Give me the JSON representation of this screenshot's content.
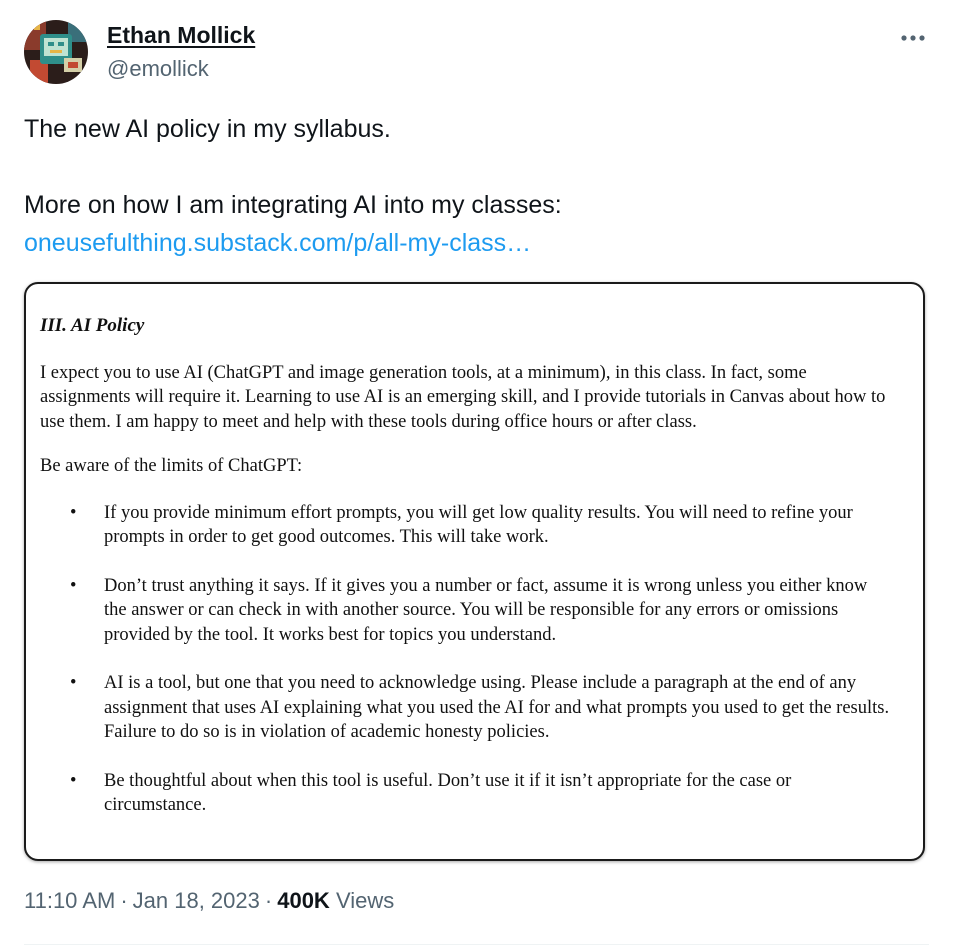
{
  "author": {
    "display_name": "Ethan Mollick",
    "handle": "@emollick",
    "avatar_icon": "pixel-art-avatar"
  },
  "more_icon": "more-options-icon",
  "tweet": {
    "line1": "The new AI policy in my syllabus.",
    "line2": "More on how I am integrating AI into my classes:",
    "link": "oneusefulthing.substack.com/p/all-my-class…"
  },
  "document": {
    "heading": "III.  AI Policy",
    "intro": "I expect you to use AI (ChatGPT and image generation tools, at a minimum), in this class. In fact, some assignments will require it. Learning to use AI is an emerging skill, and I provide tutorials in Canvas about how to use them. I am happy to meet and help with these tools during office hours or after class.",
    "subheading": "Be aware of the limits of ChatGPT:",
    "bullet_symbol": "•",
    "bullets": [
      "If you provide minimum effort prompts, you will get low quality results. You will need to refine your prompts in order to get good outcomes. This will take work.",
      "Don’t trust anything it says. If it gives you a number or fact, assume it is wrong unless you either know the answer or can check in with another source. You will be responsible for any errors or omissions provided by the tool. It works best for topics you understand.",
      "AI is a tool, but one that you need to acknowledge using. Please include a paragraph at the end of any assignment that uses AI explaining what you used the AI for and what prompts you used to get the results. Failure to do so is in violation of academic honesty policies.",
      "Be thoughtful about when this tool is useful. Don’t use it if it isn’t appropriate for the case or circumstance."
    ]
  },
  "meta": {
    "time": "11:10 AM",
    "date": "Jan 18, 2023",
    "separator": "·",
    "views_count": "400K",
    "views_label": "Views"
  },
  "colors": {
    "link": "#1d9bf0",
    "secondary_text": "#536471",
    "primary_text": "#0f1419"
  }
}
